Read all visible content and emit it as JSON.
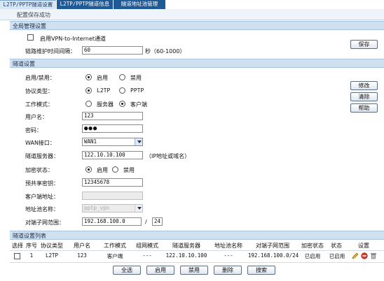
{
  "tabs": [
    "L2TP/PPTP隧道设置",
    "L2TP/PPTP隧道信息",
    "隧道地址池管理"
  ],
  "status": "配置保存成功",
  "global": {
    "title": "全局管理设置",
    "vpn_label": "启用VPN-to-Internet通道",
    "interval_label": "链路维护时间间隔：",
    "interval_value": "60",
    "interval_unit": "秒（60-1000）",
    "save": "保存"
  },
  "tunnel": {
    "title": "隧道设置",
    "enable_label": "启用/禁用：",
    "enable_opts": [
      "启用",
      "禁用"
    ],
    "protocol_label": "协议类型：",
    "protocol_opts": [
      "L2TP",
      "PPTP"
    ],
    "mode_label": "工作模式：",
    "mode_opts": [
      "服务器",
      "客户端"
    ],
    "user_label": "用户名：",
    "user_value": "123",
    "pwd_label": "密码：",
    "pwd_value": "●●●",
    "wan_label": "WAN接口：",
    "wan_value": "WAN1",
    "server_label": "隧道服务器：",
    "server_value": "122.10.10.100",
    "server_hint": "（IP地址或域名）",
    "encrypt_label": "加密状态：",
    "encrypt_opts": [
      "启用",
      "禁用"
    ],
    "psk_label": "预共享密钥：",
    "psk_value": "12345678",
    "client_addr_label": "客户端地址：",
    "client_addr_value": "",
    "pool_label": "地址池名称：",
    "pool_value": "pptp_vpn",
    "peer_label": "对端子网范围：",
    "peer_ip": "192.168.100.0",
    "peer_mask": "24",
    "slash": "/",
    "buttons": [
      "修改",
      "清除",
      "帮助"
    ]
  },
  "list": {
    "title": "隧道设置列表",
    "headers": [
      "选择",
      "序号",
      "协议类型",
      "用户名",
      "工作模式",
      "组网模式",
      "隧道服务器",
      "地址池名称",
      "对端子网范围",
      "加密状态",
      "状态",
      "设置"
    ],
    "row": [
      "1",
      "L2TP",
      "123",
      "客户端",
      "---",
      "122.10.10.100",
      "---",
      "192.168.100.0/24",
      "已启用",
      "已启用"
    ],
    "buttons": [
      "全选",
      "启用",
      "禁用",
      "删除",
      "搜索"
    ]
  },
  "colors": {
    "tab_bar": "#1f5a96",
    "section": "#cfe0f1",
    "status_bg": "#eef4fa"
  },
  "icons": [
    "edit-icon",
    "disable-icon",
    "delete-icon"
  ]
}
